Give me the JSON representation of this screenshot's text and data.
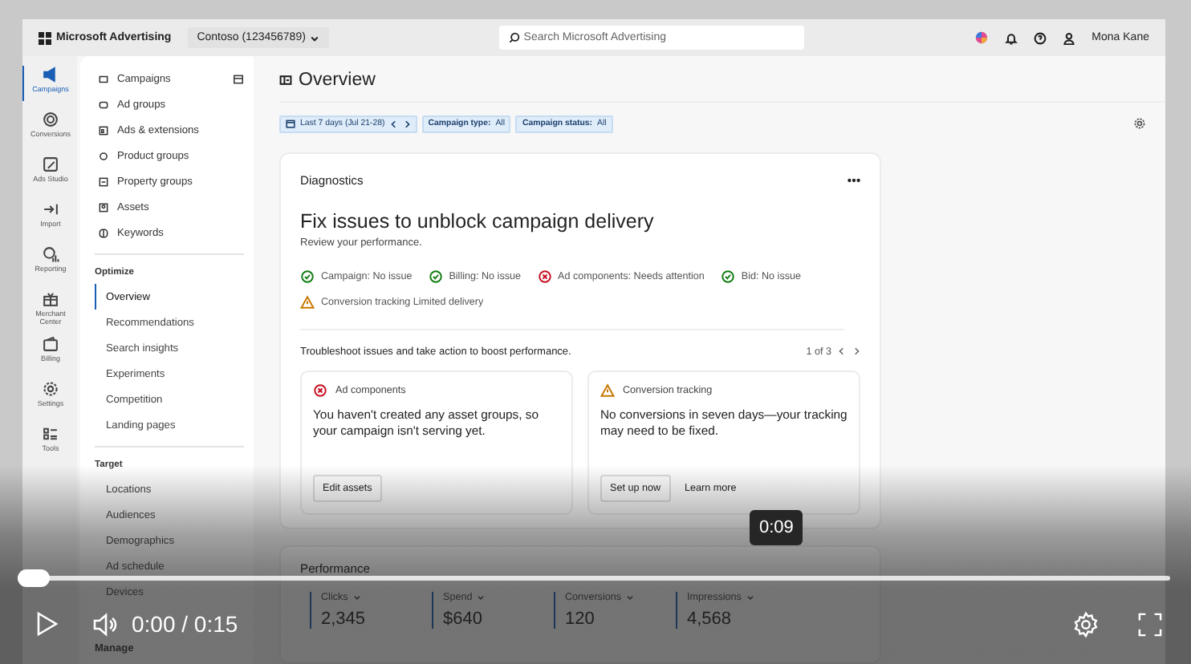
{
  "app_header": {
    "logo": "Microsoft Advertising",
    "account": "Contoso (123456789)",
    "search": {
      "placeholder": "Search Microsoft Advertising"
    },
    "user": "Mona Kane"
  },
  "rail": [
    {
      "kind": "campaigns",
      "label": "Campaigns",
      "selected": true
    },
    {
      "kind": "conversions",
      "label": "Conversions",
      "selected": false
    },
    {
      "kind": "studio",
      "label": "Ads Studio",
      "selected": false
    },
    {
      "kind": "import",
      "label": "Import",
      "selected": false
    },
    {
      "kind": "reporting",
      "label": "Reporting",
      "selected": false
    },
    {
      "kind": "merchant",
      "label": "Merchant Center",
      "selected": false
    },
    {
      "kind": "billing",
      "label": "Billing",
      "selected": false
    },
    {
      "kind": "settings",
      "label": "Settings",
      "selected": false
    },
    {
      "kind": "tools",
      "label": "Tools",
      "selected": false
    }
  ],
  "nav": {
    "entities": [
      {
        "label": "Campaigns"
      },
      {
        "label": "Ad groups"
      },
      {
        "label": "Ads & extensions"
      },
      {
        "label": "Product groups"
      },
      {
        "label": "Property groups"
      },
      {
        "label": "Assets"
      },
      {
        "label": "Keywords"
      }
    ],
    "sections": [
      {
        "heading": "Optimize",
        "items": [
          {
            "label": "Overview",
            "selected": true
          },
          {
            "label": "Recommendations",
            "selected": false
          },
          {
            "label": "Search insights",
            "selected": false
          },
          {
            "label": "Experiments",
            "selected": false
          },
          {
            "label": "Competition",
            "selected": false
          },
          {
            "label": "Landing pages",
            "selected": false
          }
        ]
      },
      {
        "heading": "Target",
        "items": [
          {
            "label": "Locations",
            "selected": false
          },
          {
            "label": "Audiences",
            "selected": false
          },
          {
            "label": "Demographics",
            "selected": false
          },
          {
            "label": "Ad schedule",
            "selected": false
          },
          {
            "label": "Devices",
            "selected": false
          }
        ]
      },
      {
        "heading": "Manage"
      }
    ]
  },
  "page": {
    "title": "Overview",
    "filters": [
      {
        "kind": "date",
        "label": "Last 7 days (Jul 21-28)"
      },
      {
        "kind": "filter",
        "label": "**Campaign type:** All"
      },
      {
        "kind": "filter",
        "label": "**Campaign status:** All"
      }
    ]
  },
  "diagnostics": {
    "title": "Diagnostics",
    "headline": "Fix issues to unblock campaign delivery",
    "subtitle": "Review your performance.",
    "statuses": [
      {
        "label": "Campaign: No issue",
        "kind": "ok"
      },
      {
        "label": "Billing: No issue",
        "kind": "ok"
      },
      {
        "label": "Ad components: Needs attention",
        "kind": "error"
      },
      {
        "label": "Bid: No issue",
        "kind": "ok"
      },
      {
        "label": "Conversion tracking Limited delivery",
        "kind": "warning"
      }
    ],
    "troubleshoot": "Troubleshoot issues and take action to boost performance.",
    "pager": "1 of 3",
    "cards": [
      {
        "kind": "error",
        "title": "Ad components",
        "body": "You haven't created any asset groups, so your campaign isn't serving yet.",
        "buttons": [
          "Edit assets"
        ]
      },
      {
        "kind": "warning",
        "title": "Conversion tracking",
        "body": "No conversions in seven days—your tracking may need to be fixed.",
        "buttons": [
          "Set up now"
        ],
        "links": [
          "Learn more"
        ]
      }
    ]
  },
  "performance": {
    "title": "Performance",
    "metrics": [
      {
        "label": "Clicks",
        "value": "2,345"
      },
      {
        "label": "Spend",
        "value": "$640"
      },
      {
        "label": "Conversions",
        "value": "120"
      },
      {
        "label": "Impressions",
        "value": "4,568"
      }
    ]
  },
  "player": {
    "progress": {
      "level": 0
    },
    "tooltip": "0:09",
    "time": "0:00 / 0:15"
  }
}
